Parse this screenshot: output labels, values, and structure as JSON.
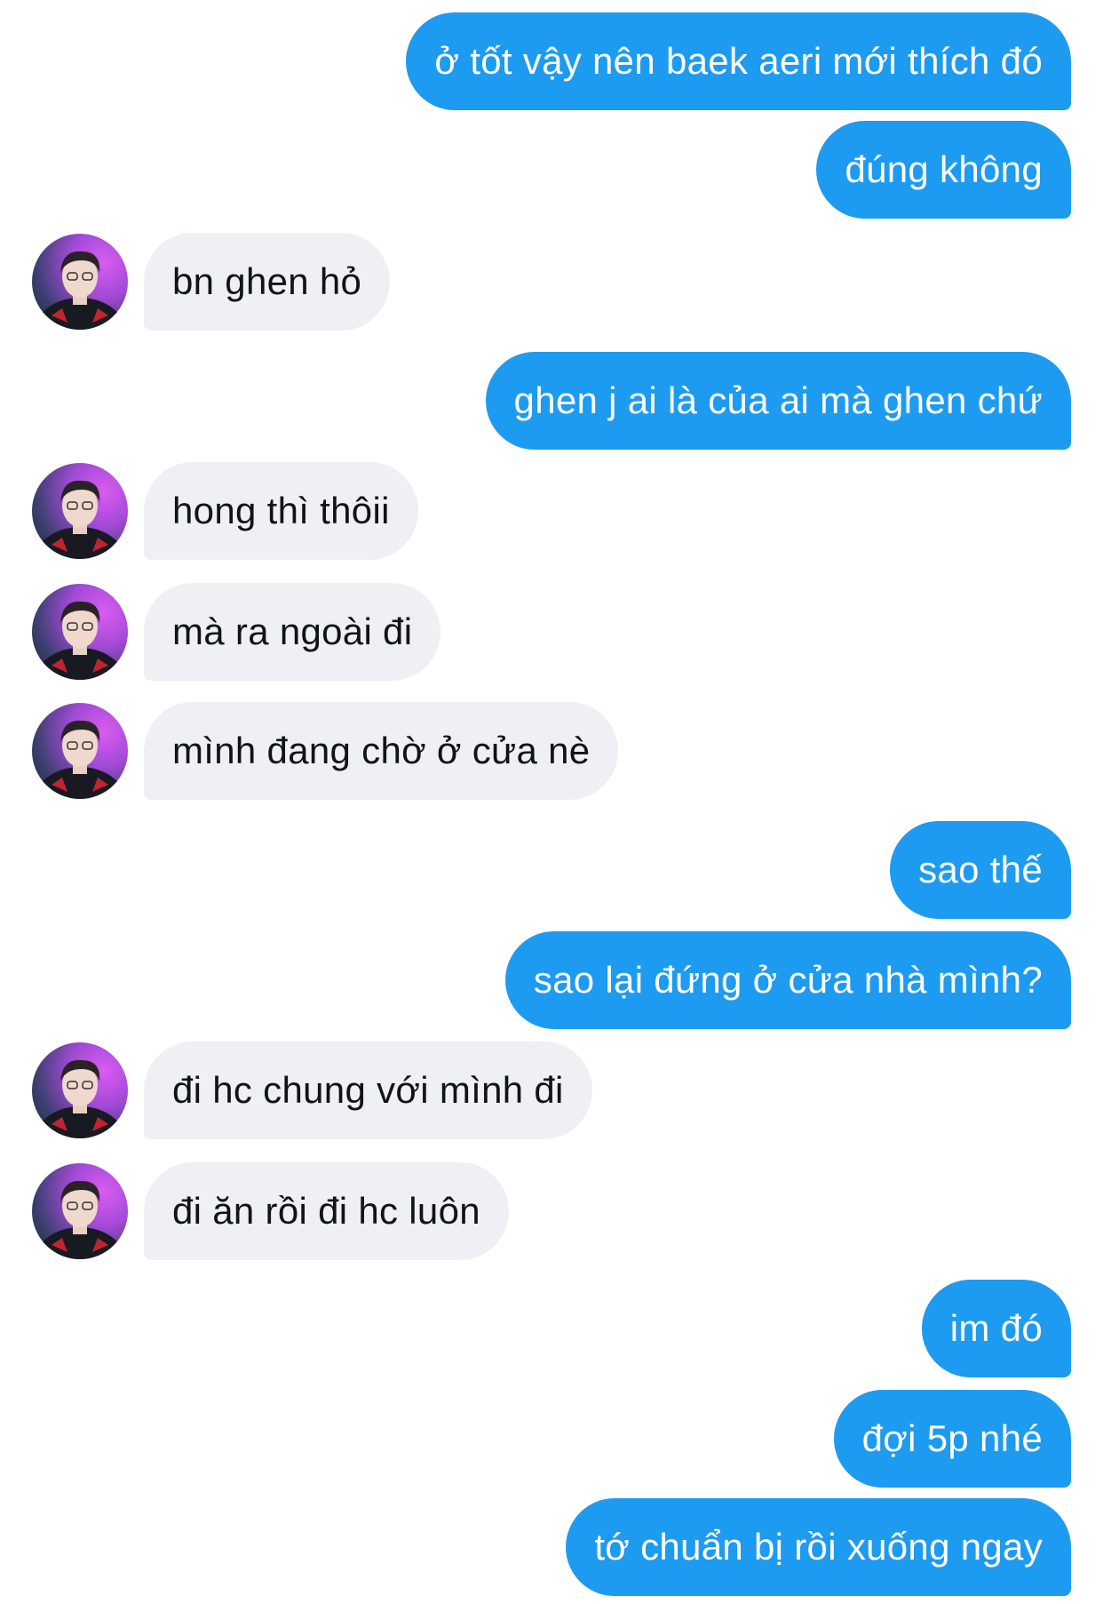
{
  "messages": [
    {
      "side": "out",
      "text": "ở tốt vậy nên baek aeri mới thích đó"
    },
    {
      "side": "out",
      "text": "đúng không"
    },
    {
      "side": "in",
      "text": "bn ghen hỏ"
    },
    {
      "side": "out",
      "text": "ghen j ai là của ai mà ghen chứ"
    },
    {
      "side": "in",
      "text": "hong thì thôii"
    },
    {
      "side": "in",
      "text": "mà ra ngoài đi"
    },
    {
      "side": "in",
      "text": "mình đang chờ ở cửa nè"
    },
    {
      "side": "out",
      "text": "sao thế"
    },
    {
      "side": "out",
      "text": "sao lại đứng ở cửa nhà mình?"
    },
    {
      "side": "in",
      "text": "đi hc chung với mình đi"
    },
    {
      "side": "in",
      "text": "đi ăn rồi đi hc luôn"
    },
    {
      "side": "out",
      "text": "im đó"
    },
    {
      "side": "out",
      "text": "đợi 5p nhé"
    },
    {
      "side": "out",
      "text": "tớ chuẩn bị rồi xuống ngay"
    }
  ],
  "colors": {
    "outgoing_bubble": "#1d9bf0",
    "incoming_bubble": "#eef0f3",
    "incoming_text": "#0f1419"
  },
  "icons": {
    "avatar": "user-avatar-photo"
  }
}
